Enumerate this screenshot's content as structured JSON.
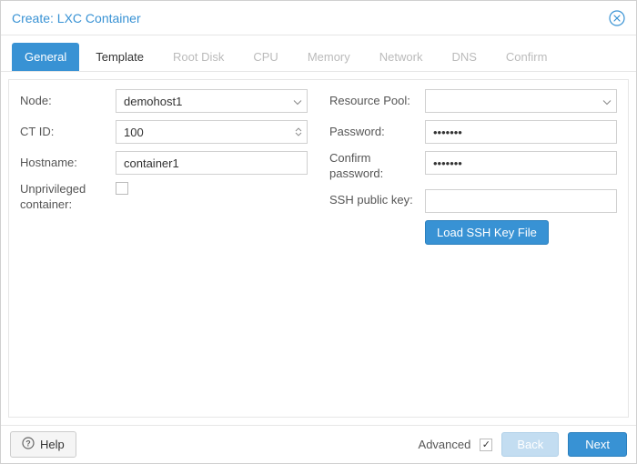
{
  "window": {
    "title": "Create: LXC Container"
  },
  "tabs": [
    {
      "label": "General",
      "active": true
    },
    {
      "label": "Template",
      "active": false,
      "next": true
    },
    {
      "label": "Root Disk",
      "active": false
    },
    {
      "label": "CPU",
      "active": false
    },
    {
      "label": "Memory",
      "active": false
    },
    {
      "label": "Network",
      "active": false
    },
    {
      "label": "DNS",
      "active": false
    },
    {
      "label": "Confirm",
      "active": false
    }
  ],
  "left_form": {
    "node": {
      "label": "Node:",
      "value": "demohost1"
    },
    "ctid": {
      "label": "CT ID:",
      "value": "100"
    },
    "hostname": {
      "label": "Hostname:",
      "value": "container1"
    },
    "unprivileged": {
      "label": "Unprivileged container:",
      "checked": false
    }
  },
  "right_form": {
    "pool": {
      "label": "Resource Pool:",
      "value": ""
    },
    "password": {
      "label": "Password:",
      "value": "•••••••"
    },
    "confirm_password": {
      "label": "Confirm password:",
      "value": "•••••••"
    },
    "ssh_key": {
      "label": "SSH public key:",
      "value": ""
    },
    "load_ssh_btn": "Load SSH Key File"
  },
  "bottom": {
    "help": "Help",
    "advanced": "Advanced",
    "advanced_checked": true,
    "back": "Back",
    "next": "Next"
  }
}
